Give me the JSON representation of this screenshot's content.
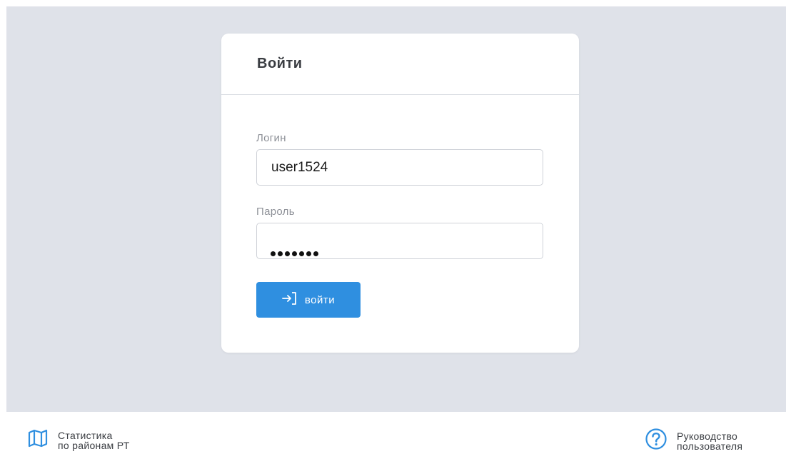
{
  "login": {
    "title": "Войти",
    "login_label": "Логин",
    "login_value": "user1524",
    "password_label": "Пароль",
    "password_length": 7,
    "submit_label": "войти",
    "submit_icon": "sign-in-icon"
  },
  "footer": {
    "stats_link": {
      "icon": "map-icon",
      "line1": "Статистика",
      "line2": "по районам РТ"
    },
    "guide_link": {
      "icon": "help-circle-icon",
      "line1": "Руководство",
      "line2": "пользователя"
    }
  },
  "colors": {
    "backdrop": "#dfe2e9",
    "accent": "#2f8fe0",
    "text": "#3a3d42",
    "label": "#8e9198"
  }
}
